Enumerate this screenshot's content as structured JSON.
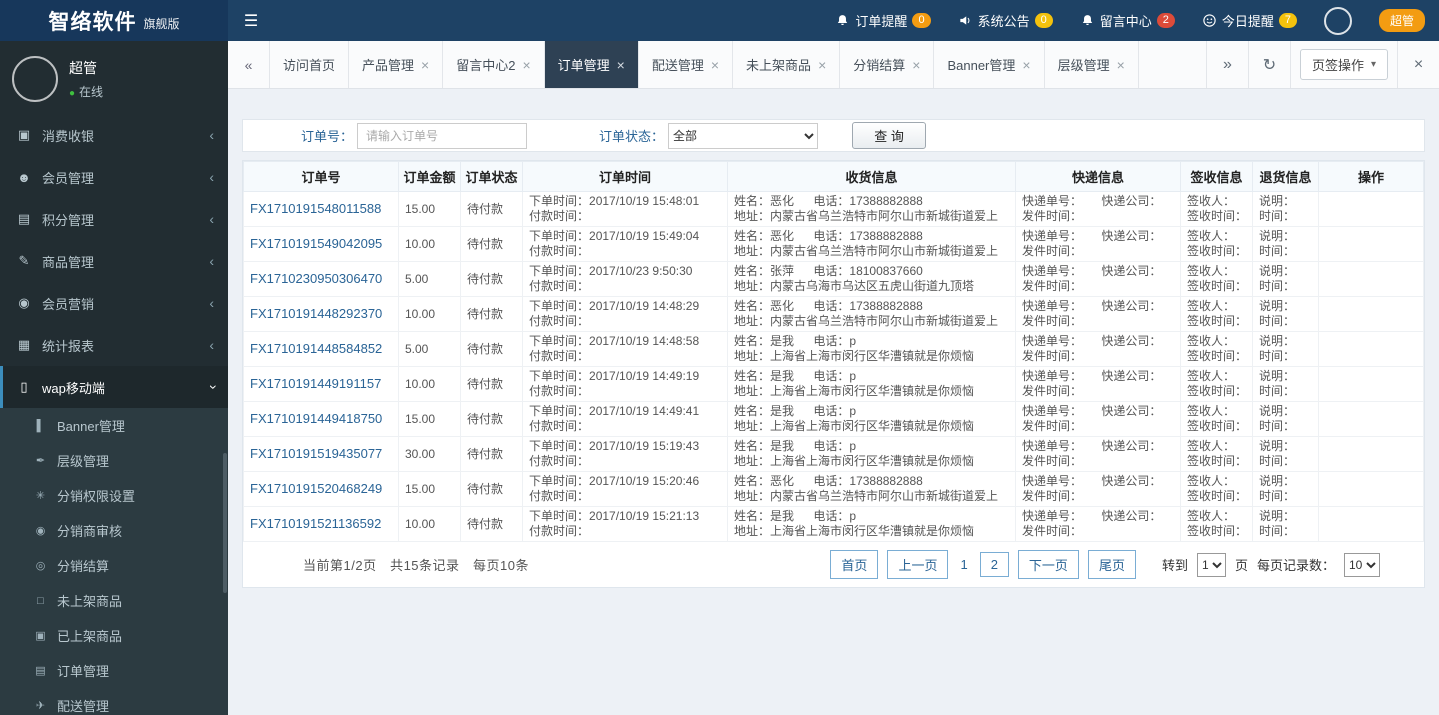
{
  "colors": {
    "header_bg": "#1e4265",
    "logo_bg": "#17375b",
    "sidebar_bg": "#222d32",
    "submenu_bg": "#2c3b41",
    "accent_blue": "#3c8dbc",
    "link_blue": "#2a6496",
    "active_tab_bg": "#2e4154",
    "badge_orange": "#f39c12",
    "badge_yellow": "#f4c20d",
    "badge_red": "#dd4b39",
    "online_green": "#3fbf3f"
  },
  "icons": {
    "hamburger": "☰",
    "chevron": "‹",
    "tab_prev": "«",
    "tab_next": "»",
    "refresh": "↻",
    "caret": "▾",
    "close": "×",
    "online_dot": "●"
  },
  "header": {
    "logo_title": "智络软件",
    "logo_subtitle": "旗舰版",
    "notifications": [
      {
        "label": "订单提醒",
        "count": "0"
      },
      {
        "label": "系统公告",
        "count": "0"
      },
      {
        "label": "留言中心",
        "count": "2"
      },
      {
        "label": "今日提醒",
        "count": "7"
      }
    ],
    "user_role_badge": "超管"
  },
  "sidebar": {
    "user": {
      "name": "超管",
      "status": "在线"
    },
    "menu": [
      {
        "label": "消费收银",
        "icon": "▣"
      },
      {
        "label": "会员管理",
        "icon": "☻"
      },
      {
        "label": "积分管理",
        "icon": "▤"
      },
      {
        "label": "商品管理",
        "icon": "✎"
      },
      {
        "label": "会员营销",
        "icon": "◉"
      },
      {
        "label": "统计报表",
        "icon": "▦"
      },
      {
        "label": "wap移动端",
        "icon": "▯"
      }
    ],
    "submenu": [
      {
        "label": "Banner管理",
        "icon": "▌"
      },
      {
        "label": "层级管理",
        "icon": "✒"
      },
      {
        "label": "分销权限设置",
        "icon": "✳"
      },
      {
        "label": "分销商审核",
        "icon": "◉"
      },
      {
        "label": "分销结算",
        "icon": "◎"
      },
      {
        "label": "未上架商品",
        "icon": "□"
      },
      {
        "label": "已上架商品",
        "icon": "▣"
      },
      {
        "label": "订单管理",
        "icon": "▤"
      },
      {
        "label": "配送管理",
        "icon": "✈"
      }
    ]
  },
  "tabs": {
    "items": [
      {
        "label": "访问首页"
      },
      {
        "label": "产品管理"
      },
      {
        "label": "留言中心2"
      },
      {
        "label": "订单管理"
      },
      {
        "label": "配送管理"
      },
      {
        "label": "未上架商品"
      },
      {
        "label": "分销结算"
      },
      {
        "label": "Banner管理"
      },
      {
        "label": "层级管理"
      }
    ],
    "ops_label": "页签操作"
  },
  "search": {
    "order_no_label": "订单号：",
    "order_no_placeholder": "请输入订单号",
    "status_label": "订单状态：",
    "status_value": "全部",
    "query_label": "查 询"
  },
  "table": {
    "headers": [
      "订单号",
      "订单金额",
      "订单状态",
      "订单时间",
      "收货信息",
      "快递信息",
      "签收信息",
      "退货信息",
      "操作"
    ],
    "labels": {
      "place_time": "下单时间：",
      "pay_time": "付款时间：",
      "name": "姓名：",
      "phone": "电话：",
      "address": "地址：",
      "tracking_no": "快递单号：",
      "courier": "快递公司：",
      "ship_time": "发件时间：",
      "sign_person": "签收人：",
      "sign_time": "签收时间：",
      "return_note": "说明：",
      "return_time": "时间："
    },
    "rows": [
      {
        "order_no": "FX1710191548011588",
        "amount": "15.00",
        "status": "待付款",
        "order_time": "2017/10/19 15:48:01",
        "name": "恶化",
        "phone": "17388882888",
        "address": "内蒙古省乌兰浩特市阿尔山市新城街道爱上"
      },
      {
        "order_no": "FX1710191549042095",
        "amount": "10.00",
        "status": "待付款",
        "order_time": "2017/10/19 15:49:04",
        "name": "恶化",
        "phone": "17388882888",
        "address": "内蒙古省乌兰浩特市阿尔山市新城街道爱上"
      },
      {
        "order_no": "FX1710230950306470",
        "amount": "5.00",
        "status": "待付款",
        "order_time": "2017/10/23 9:50:30",
        "name": "张萍",
        "phone": "18100837660",
        "address": "内蒙古乌海市乌达区五虎山街道九顶塔"
      },
      {
        "order_no": "FX1710191448292370",
        "amount": "10.00",
        "status": "待付款",
        "order_time": "2017/10/19 14:48:29",
        "name": "恶化",
        "phone": "17388882888",
        "address": "内蒙古省乌兰浩特市阿尔山市新城街道爱上"
      },
      {
        "order_no": "FX1710191448584852",
        "amount": "5.00",
        "status": "待付款",
        "order_time": "2017/10/19 14:48:58",
        "name": "是我",
        "phone": "p",
        "address": "上海省上海市闵行区华漕镇就是你烦恼"
      },
      {
        "order_no": "FX1710191449191157",
        "amount": "10.00",
        "status": "待付款",
        "order_time": "2017/10/19 14:49:19",
        "name": "是我",
        "phone": "p",
        "address": "上海省上海市闵行区华漕镇就是你烦恼"
      },
      {
        "order_no": "FX1710191449418750",
        "amount": "15.00",
        "status": "待付款",
        "order_time": "2017/10/19 14:49:41",
        "name": "是我",
        "phone": "p",
        "address": "上海省上海市闵行区华漕镇就是你烦恼"
      },
      {
        "order_no": "FX1710191519435077",
        "amount": "30.00",
        "status": "待付款",
        "order_time": "2017/10/19 15:19:43",
        "name": "是我",
        "phone": "p",
        "address": "上海省上海市闵行区华漕镇就是你烦恼"
      },
      {
        "order_no": "FX1710191520468249",
        "amount": "15.00",
        "status": "待付款",
        "order_time": "2017/10/19 15:20:46",
        "name": "恶化",
        "phone": "17388882888",
        "address": "内蒙古省乌兰浩特市阿尔山市新城街道爱上"
      },
      {
        "order_no": "FX1710191521136592",
        "amount": "10.00",
        "status": "待付款",
        "order_time": "2017/10/19 15:21:13",
        "name": "是我",
        "phone": "p",
        "address": "上海省上海市闵行区华漕镇就是你烦恼"
      }
    ]
  },
  "pagination": {
    "summary": "当前第1/2页　共15条记录　每页10条",
    "first": "首页",
    "prev": "上一页",
    "pages": [
      "1",
      "2"
    ],
    "next": "下一页",
    "last": "尾页",
    "goto_label": "转到",
    "goto_value": "1",
    "goto_unit": "页",
    "size_label": "每页记录数：",
    "size_value": "10"
  }
}
